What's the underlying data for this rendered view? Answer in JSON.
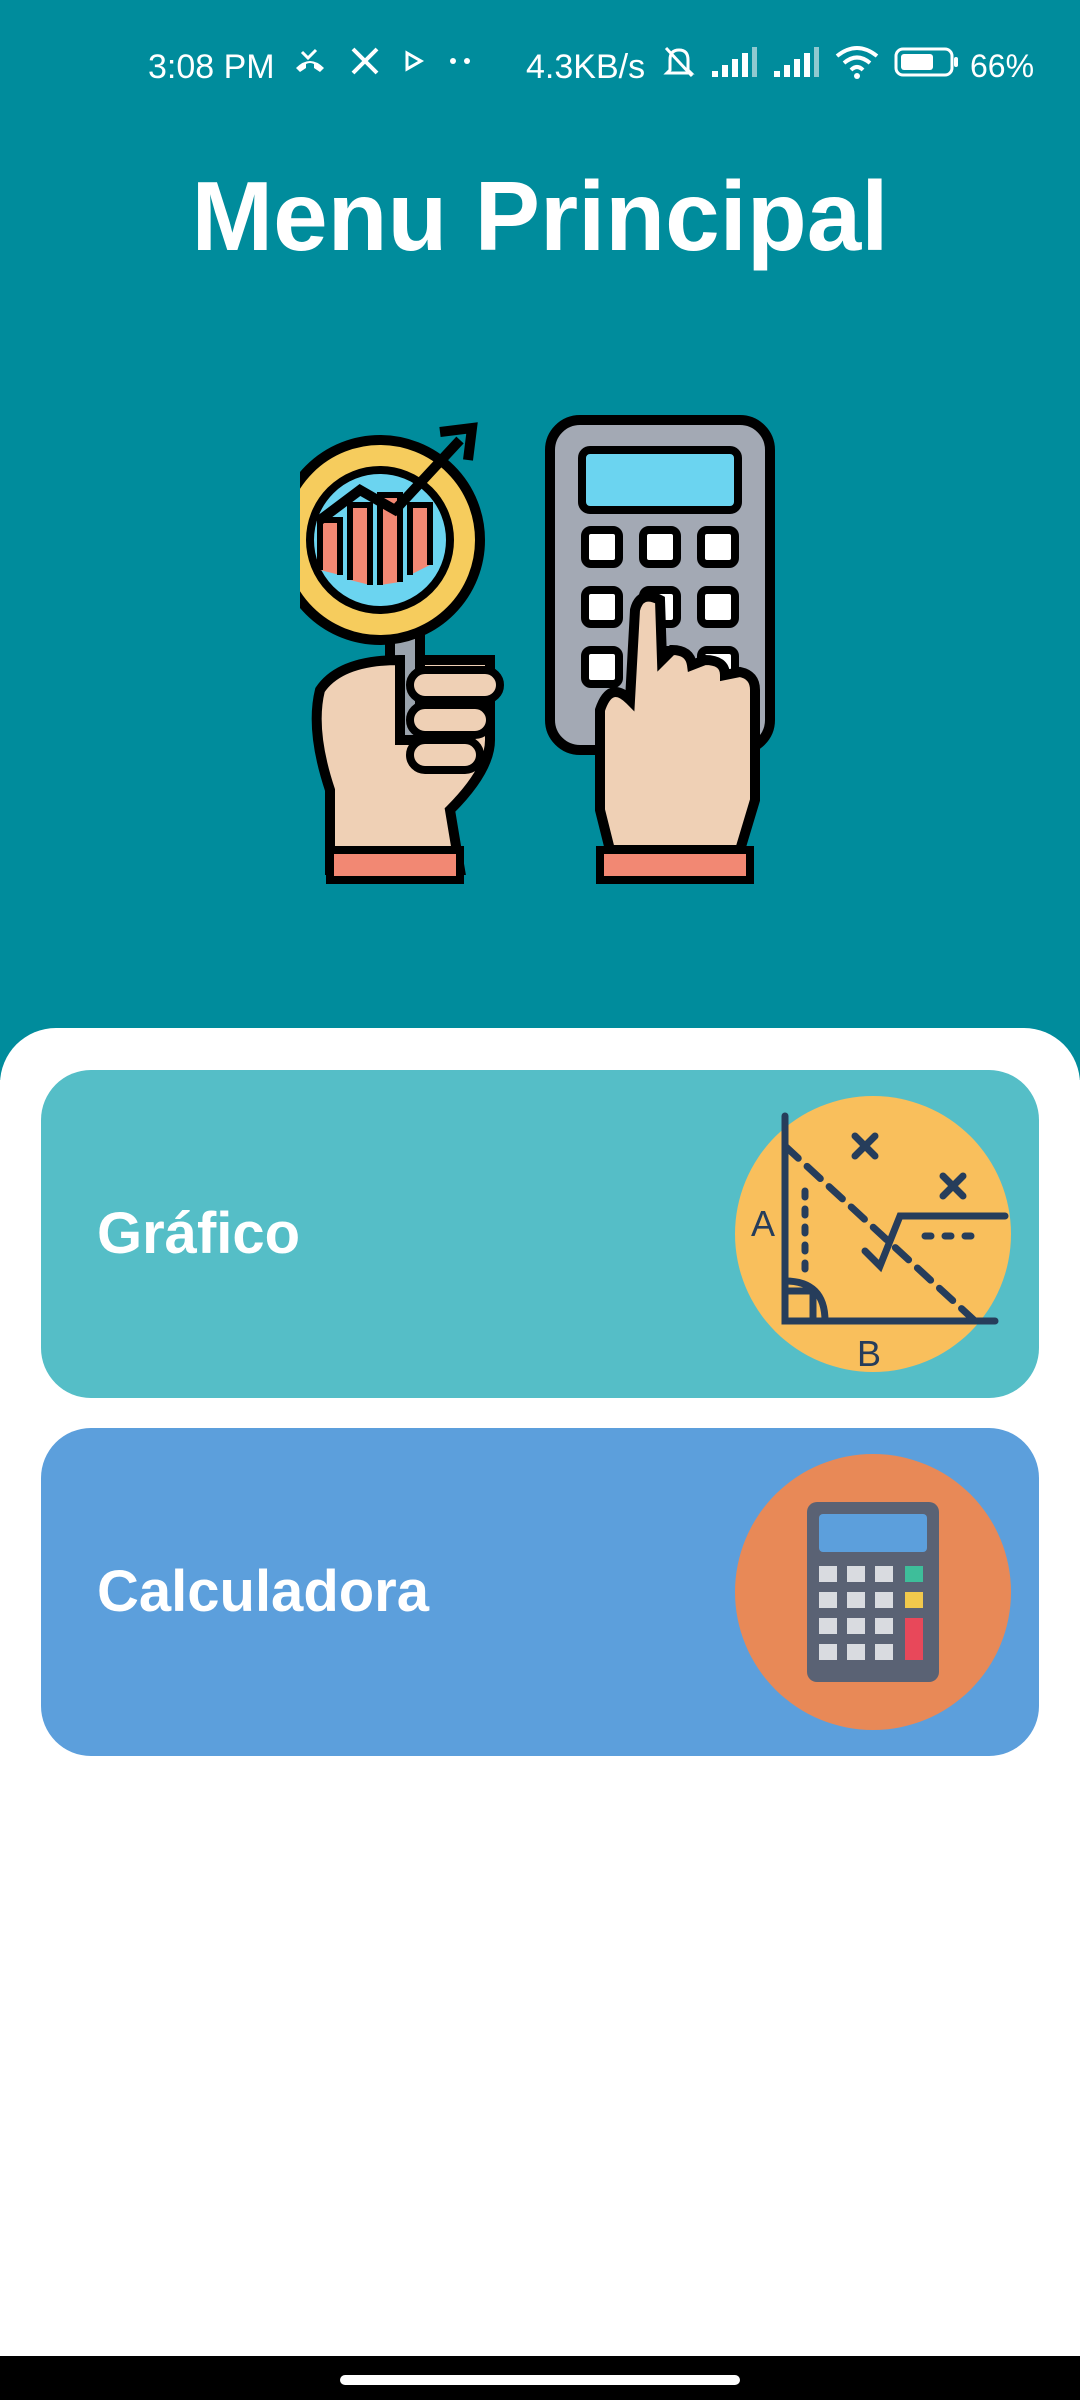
{
  "status_bar": {
    "time": "3:08 PM",
    "network_speed": "4.3KB/s",
    "battery": "66%",
    "icons": [
      "missed-call-icon",
      "x-logo-icon",
      "play-icon",
      "more-dots-icon",
      "bell-off-icon",
      "signal-icon",
      "signal-icon",
      "wifi-icon",
      "battery-icon"
    ]
  },
  "header": {
    "title": "Menu Principal",
    "hero_image": "hand-calculator-magnifier-illustration",
    "background": "#008C9C"
  },
  "menu": {
    "items": [
      {
        "label": "Gráfico",
        "icon": "geometry-graph-icon",
        "color": "#55BEC7"
      },
      {
        "label": "Calculadora",
        "icon": "calculator-icon",
        "color": "#5C9FDC"
      }
    ]
  }
}
